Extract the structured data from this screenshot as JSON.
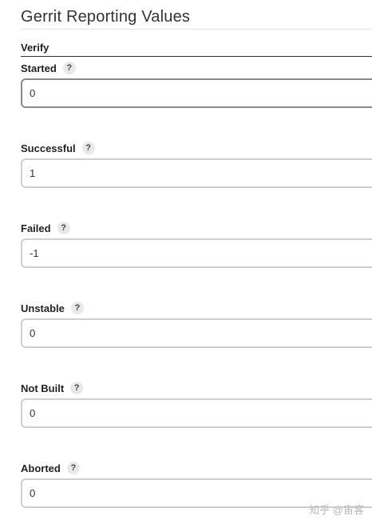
{
  "section": {
    "title": "Gerrit Reporting Values"
  },
  "subsection": {
    "title": "Verify"
  },
  "fields": [
    {
      "label": "Started",
      "value": "0",
      "help": "?"
    },
    {
      "label": "Successful",
      "value": "1",
      "help": "?"
    },
    {
      "label": "Failed",
      "value": "-1",
      "help": "?"
    },
    {
      "label": "Unstable",
      "value": "0",
      "help": "?"
    },
    {
      "label": "Not Built",
      "value": "0",
      "help": "?"
    },
    {
      "label": "Aborted",
      "value": "0",
      "help": "?"
    }
  ],
  "watermark": {
    "text": "知乎 @宙客"
  }
}
